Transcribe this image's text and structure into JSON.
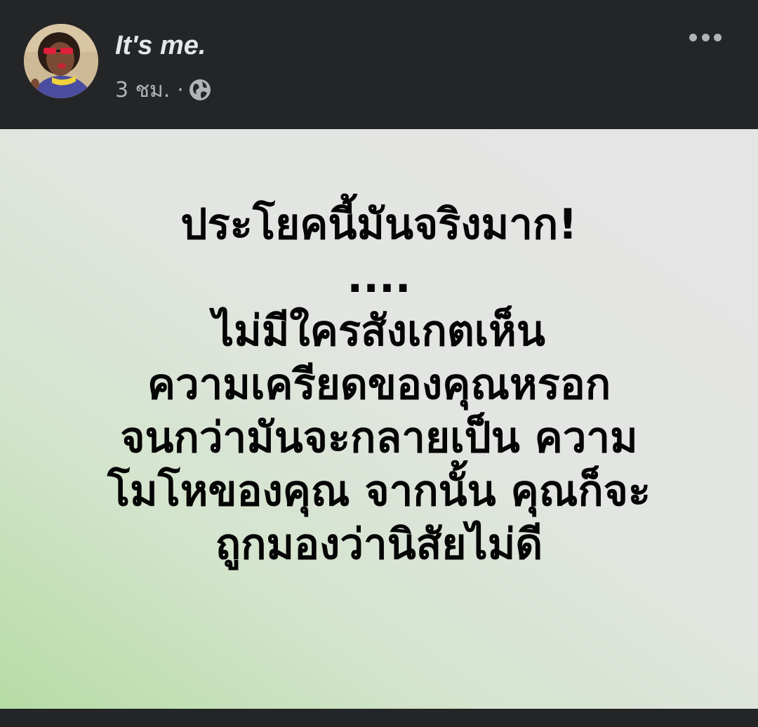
{
  "post": {
    "author": "It's me.",
    "timestamp": "3 ชม.",
    "separator": "·",
    "privacy_icon": "globe-icon",
    "more_icon": "more-options-icon",
    "background_gradient": [
      "#b6dca6",
      "#e5e5e5"
    ],
    "text_color": "#050505",
    "lines": [
      "ประโยคนี้มันจริงมาก!",
      "....",
      "ไม่มีใครสังเกตเห็น",
      "ความเครียดของคุณหรอก",
      "จนกว่ามันจะกลายเป็น ความ",
      "โมโหของคุณ จากนั้น คุณก็จะ",
      "ถูกมองว่านิสัยไม่ดี"
    ]
  }
}
